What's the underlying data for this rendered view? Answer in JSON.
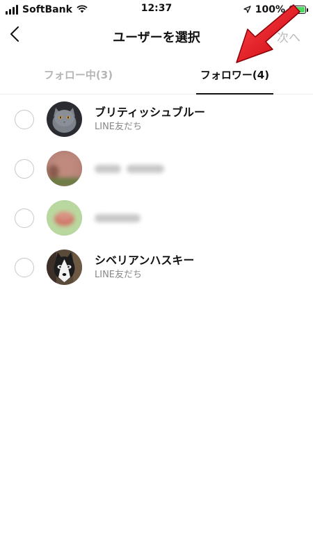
{
  "status_bar": {
    "carrier": "SoftBank",
    "time": "12:37",
    "battery_percent": "100%"
  },
  "header": {
    "title": "ユーザーを選択",
    "next_label": "次へ"
  },
  "tabs": [
    {
      "label": "フォロー中(3)",
      "active": false
    },
    {
      "label": "フォロワー(4)",
      "active": true
    }
  ],
  "users": [
    {
      "name": "ブリティッシュブルー",
      "subtitle": "LINE友だち",
      "selected": false
    },
    {
      "name": "",
      "subtitle": "",
      "selected": false,
      "blurred": true
    },
    {
      "name": "",
      "subtitle": "",
      "selected": false,
      "blurred": true
    },
    {
      "name": "シベリアンハスキー",
      "subtitle": "LINE友だち",
      "selected": false
    }
  ],
  "colors": {
    "accent_arrow": "#e8101a",
    "battery_fill": "#4cd964",
    "inactive_text": "#b5b5b5"
  }
}
